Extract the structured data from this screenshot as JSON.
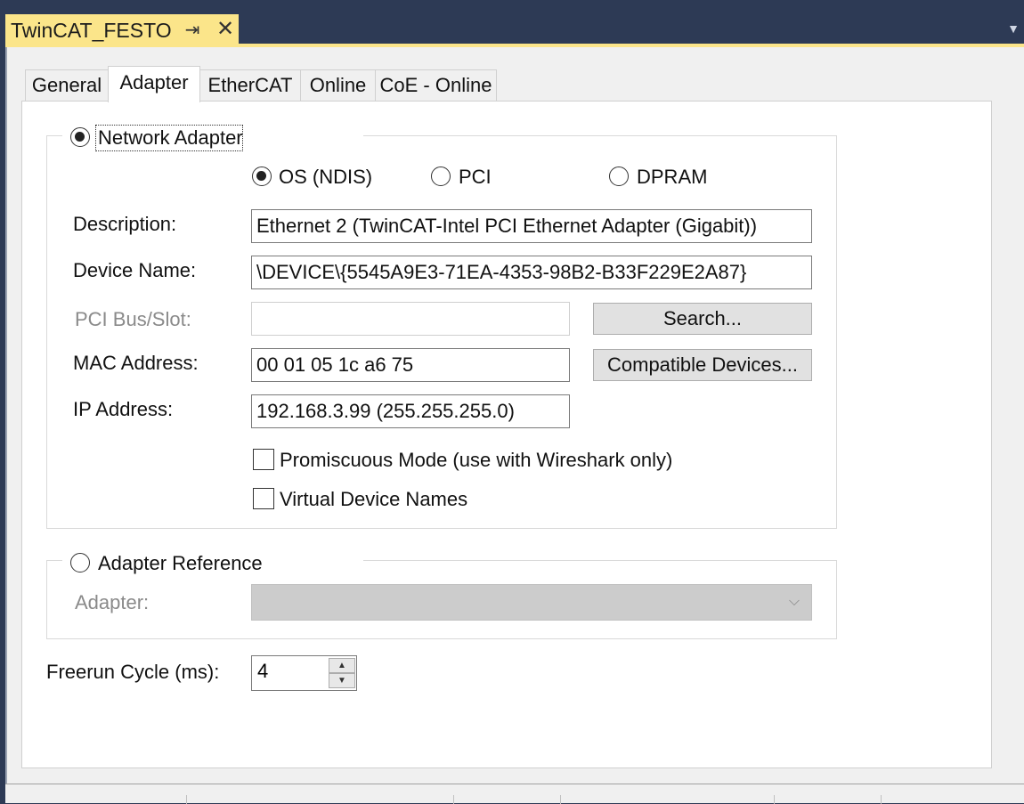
{
  "document_tab": {
    "title": "TwinCAT_FESTO",
    "pin_icon": "pin-icon",
    "close_icon": "close-icon"
  },
  "tabs": [
    {
      "label": "General",
      "active": false
    },
    {
      "label": "Adapter",
      "active": true
    },
    {
      "label": "EtherCAT",
      "active": false
    },
    {
      "label": "Online",
      "active": false
    },
    {
      "label": "CoE - Online",
      "active": false
    }
  ],
  "network_adapter": {
    "label": "Network Adapter",
    "selected": true,
    "mode_options": [
      {
        "label": "OS (NDIS)",
        "selected": true
      },
      {
        "label": "PCI",
        "selected": false
      },
      {
        "label": "DPRAM",
        "selected": false
      }
    ],
    "description": {
      "label": "Description:",
      "value": "Ethernet 2 (TwinCAT-Intel PCI Ethernet Adapter (Gigabit))"
    },
    "device_name": {
      "label": "Device Name:",
      "value": "\\DEVICE\\{5545A9E3-71EA-4353-98B2-B33F229E2A87}"
    },
    "pci_bus_slot": {
      "label": "PCI Bus/Slot:",
      "value": ""
    },
    "search_button": "Search...",
    "mac_address": {
      "label": "MAC Address:",
      "value": "00 01 05 1c a6 75"
    },
    "compatible_button": "Compatible Devices...",
    "ip_address": {
      "label": "IP Address:",
      "value": "192.168.3.99 (255.255.255.0)"
    },
    "promiscuous": {
      "label": "Promiscuous Mode (use with Wireshark only)",
      "checked": false
    },
    "virtual_names": {
      "label": "Virtual Device Names",
      "checked": false
    }
  },
  "adapter_reference": {
    "label": "Adapter Reference",
    "selected": false,
    "adapter_label": "Adapter:",
    "adapter_value": ""
  },
  "freerun": {
    "label": "Freerun Cycle (ms):",
    "value": "4"
  }
}
